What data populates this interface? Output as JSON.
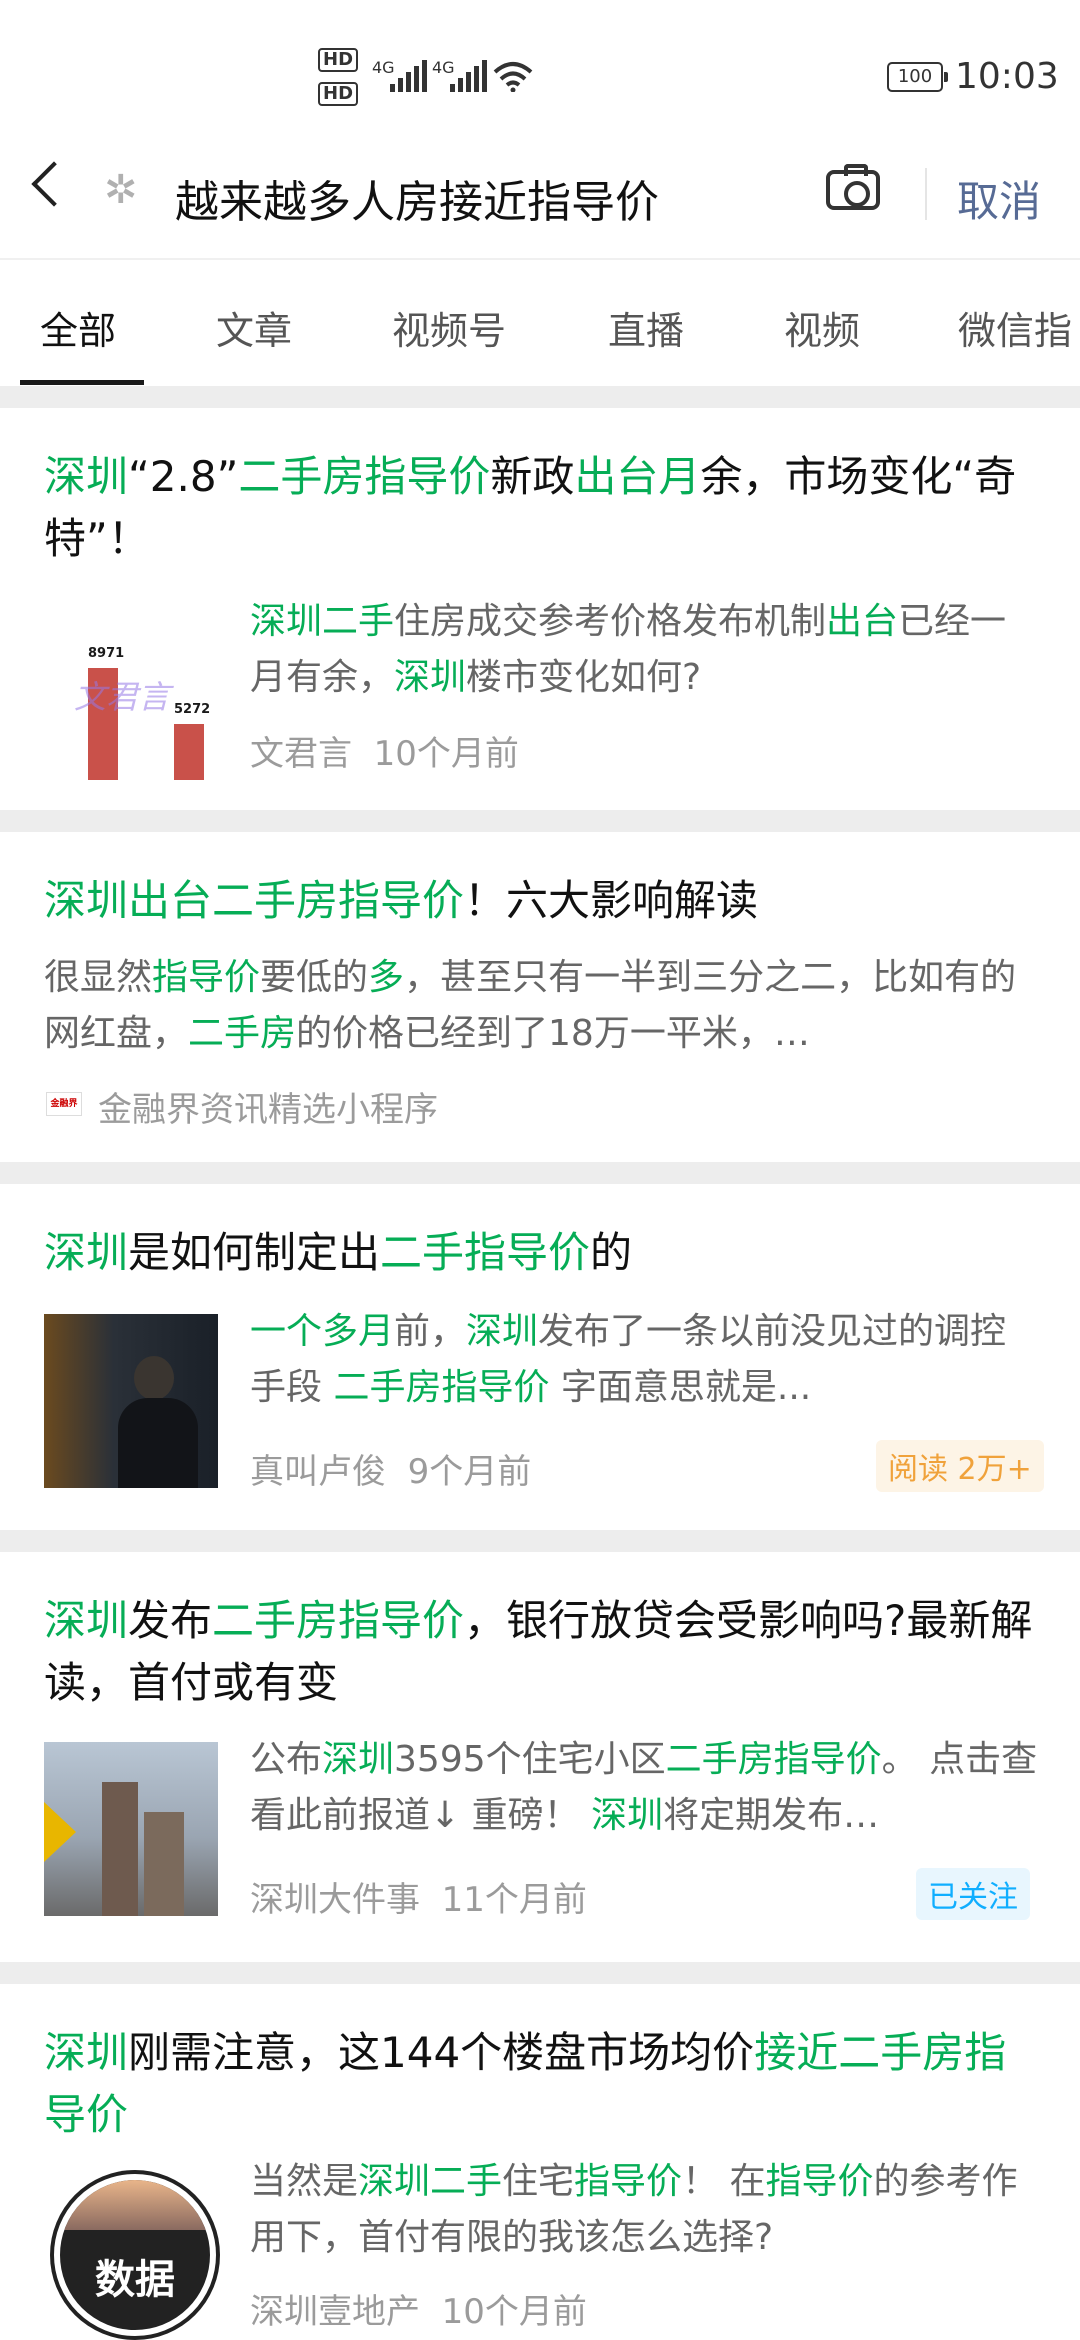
{
  "status_bar": {
    "time": "10:03",
    "battery": "100",
    "hd1": "HD",
    "hd2": "HD",
    "net1": "4G",
    "net2": "4G"
  },
  "search": {
    "query": "越来越多人房接近指导价",
    "cancel_label": "取消"
  },
  "tabs": [
    "全部",
    "文章",
    "视频号",
    "直播",
    "视频",
    "微信指"
  ],
  "colors": {
    "highlight": "#06ad56",
    "link": "#576b95",
    "meta": "#9b9b9b",
    "read_badge": "#f0a23b"
  },
  "results": [
    {
      "title_parts": [
        [
          "深圳",
          "g"
        ],
        [
          "“2.8”",
          ""
        ],
        [
          "二手房指导价",
          "g"
        ],
        [
          "新政",
          ""
        ],
        [
          "出台月",
          "g"
        ],
        [
          "余，市场变化“奇特”！",
          ""
        ]
      ],
      "desc_parts": [
        [
          "深圳二手",
          "g"
        ],
        [
          "住房成交参考价格发布机制",
          ""
        ],
        [
          "出台",
          "g"
        ],
        [
          "已经一月有余，",
          ""
        ],
        [
          "深圳",
          "g"
        ],
        [
          "楼市变化如何?",
          ""
        ]
      ],
      "source": "文君言",
      "time": "10个月前",
      "thumb_labels": {
        "a": "8971",
        "b": "5272",
        "watermark": "文君言"
      }
    },
    {
      "title_parts": [
        [
          "深圳出台二手房指导价",
          "g"
        ],
        [
          "！六大影响解读",
          ""
        ]
      ],
      "desc_parts": [
        [
          "很显然",
          ""
        ],
        [
          "指导价",
          "g"
        ],
        [
          "要低的",
          ""
        ],
        [
          "多",
          "g"
        ],
        [
          "，甚至只有一半到三分之二，比如有的网红盘，",
          ""
        ],
        [
          "二手房",
          "g"
        ],
        [
          "的价格已经到了18万一平米，…",
          ""
        ]
      ],
      "source": "金融界资讯精选小程序",
      "source_logo": "金融界"
    },
    {
      "title_parts": [
        [
          "深圳",
          "g"
        ],
        [
          "是如何制定出",
          ""
        ],
        [
          "二手指导价",
          "g"
        ],
        [
          "的",
          ""
        ]
      ],
      "desc_parts": [
        [
          "一个多月",
          "g"
        ],
        [
          "前，",
          ""
        ],
        [
          "深圳",
          "g"
        ],
        [
          "发布了一条以前没见过的调控手段 ",
          ""
        ],
        [
          "二手房指导价",
          "g"
        ],
        [
          " 字面意思就是...",
          ""
        ]
      ],
      "source": "真叫卢俊",
      "time": "9个月前",
      "badge": "阅读 2万+"
    },
    {
      "title_parts": [
        [
          "深圳",
          "g"
        ],
        [
          "发布",
          ""
        ],
        [
          "二手房指导价",
          "g"
        ],
        [
          "，银行放贷会受影响吗?最新解读，首付或有变",
          ""
        ]
      ],
      "desc_parts": [
        [
          "公布",
          ""
        ],
        [
          "深圳",
          "g"
        ],
        [
          "3595个住宅小区",
          ""
        ],
        [
          "二手房指导价",
          "g"
        ],
        [
          "。 点击查看此前报道↓ 重磅！ ",
          ""
        ],
        [
          "深圳",
          "g"
        ],
        [
          "将定期发布…",
          ""
        ]
      ],
      "source": "深圳大件事",
      "time": "11个月前",
      "badge": "已关注"
    },
    {
      "title_parts": [
        [
          "深圳",
          "g"
        ],
        [
          "刚需注意，这144个楼盘市场均价",
          ""
        ],
        [
          "接近二手房指导价",
          "g"
        ]
      ],
      "desc_parts": [
        [
          "当然是",
          ""
        ],
        [
          "深圳二手",
          "g"
        ],
        [
          "住宅",
          ""
        ],
        [
          "指导价",
          "g"
        ],
        [
          "！ 在",
          ""
        ],
        [
          "指导价",
          "g"
        ],
        [
          "的参考作用下，首付有限的我该怎么选择?",
          ""
        ]
      ],
      "source": "深圳壹地产",
      "time": "10个月前",
      "thumb_text": "数据"
    }
  ]
}
